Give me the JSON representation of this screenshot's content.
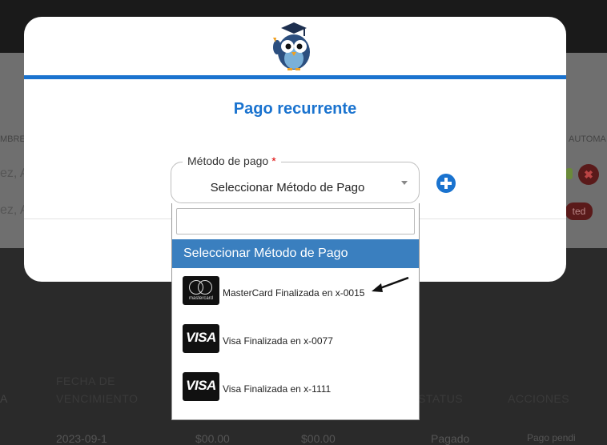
{
  "background": {
    "column_headers": [
      "FECHA DE",
      "VENCIMIENTO",
      "STATUS",
      "ACCIONES"
    ],
    "partial_text": [
      "MBRE",
      "AUTOMA",
      "ez, A",
      "ez, A",
      "A"
    ],
    "row_values": [
      "2023-09-1",
      "$00.00",
      "$00.00",
      "Pagado",
      "Pago pendi"
    ],
    "badge_text": "ted"
  },
  "modal": {
    "title": "Pago recurrente",
    "logo_icon": "owl-graduate-logo-icon",
    "accent_color": "#1a73cf"
  },
  "payment_field": {
    "label": "Método de pago",
    "required_mark": "*",
    "value": "Seleccionar Método de Pago",
    "add_icon": "plus-circle-icon"
  },
  "dropdown": {
    "search_value": "",
    "selected_label": "Seleccionar Método de Pago",
    "options": [
      {
        "label": "MasterCard Finalizada en x-0015",
        "brand": "mastercard",
        "icon_text": "mastercard"
      },
      {
        "label": "Visa Finalizada en x-0077",
        "brand": "visa",
        "icon_text": "VISA"
      },
      {
        "label": "Visa Finalizada en x-1111",
        "brand": "visa",
        "icon_text": "VISA"
      }
    ]
  },
  "annotation_icon": "arrow-pointer-icon"
}
